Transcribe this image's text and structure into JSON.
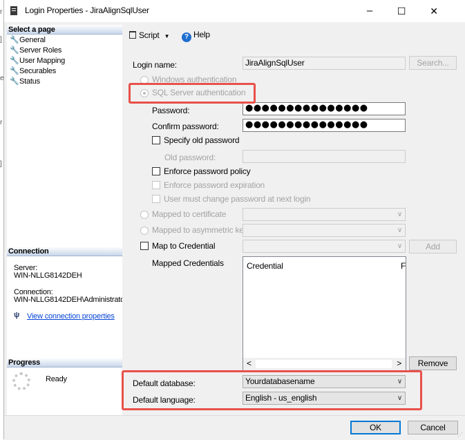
{
  "window": {
    "title": "Login Properties - JiraAlignSqlUser"
  },
  "titlebar_buttons": {
    "minimize": "–",
    "maximize": "☐",
    "close": "✕"
  },
  "left_pane": {
    "select_page_header": "Select a page",
    "pages": [
      "General",
      "Server Roles",
      "User Mapping",
      "Securables",
      "Status"
    ],
    "connection_header": "Connection",
    "server_label": "Server:",
    "server_value": "WIN-NLLG8142DEH",
    "connection_label": "Connection:",
    "connection_value": "WIN-NLLG8142DEH\\Administrato",
    "view_connection_link": "View connection properties",
    "progress_header": "Progress",
    "progress_status": "Ready"
  },
  "toolbar": {
    "script_label": "Script",
    "help_label": "Help"
  },
  "form": {
    "login_name_label": "Login name:",
    "login_name_value": "JiraAlignSqlUser",
    "search_button": "Search...",
    "windows_auth": "Windows authentication",
    "sql_auth": "SQL Server authentication",
    "password_label": "Password:",
    "password_value": "●●●●●●●●●●●●●●●",
    "confirm_password_label": "Confirm password:",
    "confirm_password_value": "●●●●●●●●●●●●●●●",
    "specify_old_password": "Specify old password",
    "old_password_label": "Old password:",
    "enforce_policy": "Enforce password policy",
    "enforce_expiration": "Enforce password expiration",
    "must_change": "User must change password at next login",
    "mapped_certificate": "Mapped to certificate",
    "mapped_asym_key": "Mapped to asymmetric key",
    "map_to_credential": "Map to Credential",
    "add_button": "Add",
    "mapped_credentials_label": "Mapped Credentials",
    "credential_col": "Credential",
    "provider_col_partial": "F",
    "remove_button": "Remove",
    "default_database_label": "Default database:",
    "default_database_value": "Yourdatabasename",
    "default_language_label": "Default language:",
    "default_language_value": "English - us_english"
  },
  "footer": {
    "ok_button": "OK",
    "cancel_button": "Cancel"
  },
  "colors": {
    "highlight": "#e8504a",
    "link": "#0645d6",
    "help_icon": "#1f6fd1"
  }
}
